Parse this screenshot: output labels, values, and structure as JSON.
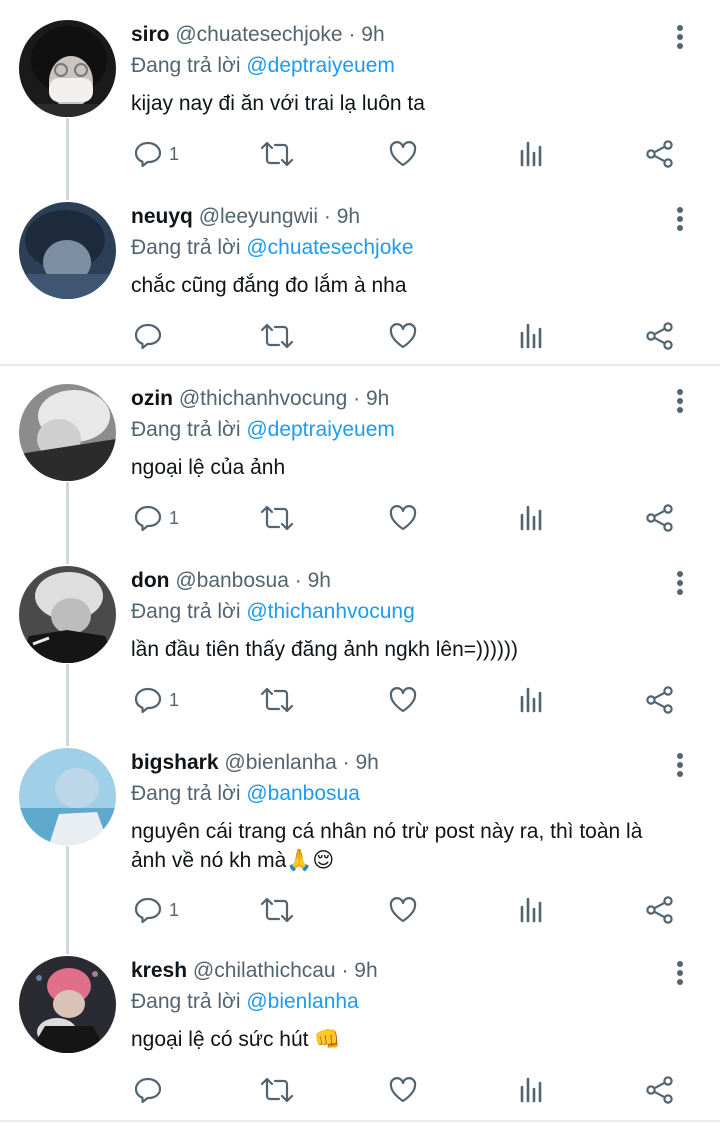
{
  "replying_prefix": "Đang trả lời",
  "tweets": [
    {
      "name": "siro",
      "handle": "@chuatesechjoke",
      "time": "· 9h",
      "reply_to": "@deptraiyeuem",
      "lines": [
        "kijay nay đi ăn với trai lạ luôn ta"
      ],
      "reply_count": "1"
    },
    {
      "name": "neuyq",
      "handle": "@leeyungwii",
      "time": "· 9h",
      "reply_to": "@chuatesechjoke",
      "lines": [
        "chắc cũng đắng đo lắm à nha"
      ],
      "reply_count": ""
    },
    {
      "name": "ozin",
      "handle": "@thichanhvocung",
      "time": "· 9h",
      "reply_to": "@deptraiyeuem",
      "lines": [
        "ngoại lệ của ảnh"
      ],
      "reply_count": "1"
    },
    {
      "name": "don",
      "handle": "@banbosua",
      "time": "· 9h",
      "reply_to": "@thichanhvocung",
      "lines": [
        "lần đầu tiên thấy đăng ảnh ngkh lên=))))))"
      ],
      "reply_count": "1"
    },
    {
      "name": "bigshark",
      "handle": "@bienlanha",
      "time": "· 9h",
      "reply_to": "@banbosua",
      "lines": [
        "nguyên cái trang cá nhân nó trừ post này ra, thì toàn là",
        "ảnh về nó kh mà🙏😌"
      ],
      "reply_count": "1"
    },
    {
      "name": "kresh",
      "handle": "@chilathichcau",
      "time": "· 9h",
      "reply_to": "@bienlanha",
      "lines": [
        "ngoại lệ có sức hút 👊"
      ],
      "reply_count": ""
    }
  ],
  "colors": {
    "accent": "#1d9bf0",
    "muted": "#536471",
    "text": "#0f1419"
  },
  "icons": [
    "reply-icon",
    "retweet-icon",
    "like-icon",
    "stats-icon",
    "share-icon",
    "more-icon"
  ]
}
